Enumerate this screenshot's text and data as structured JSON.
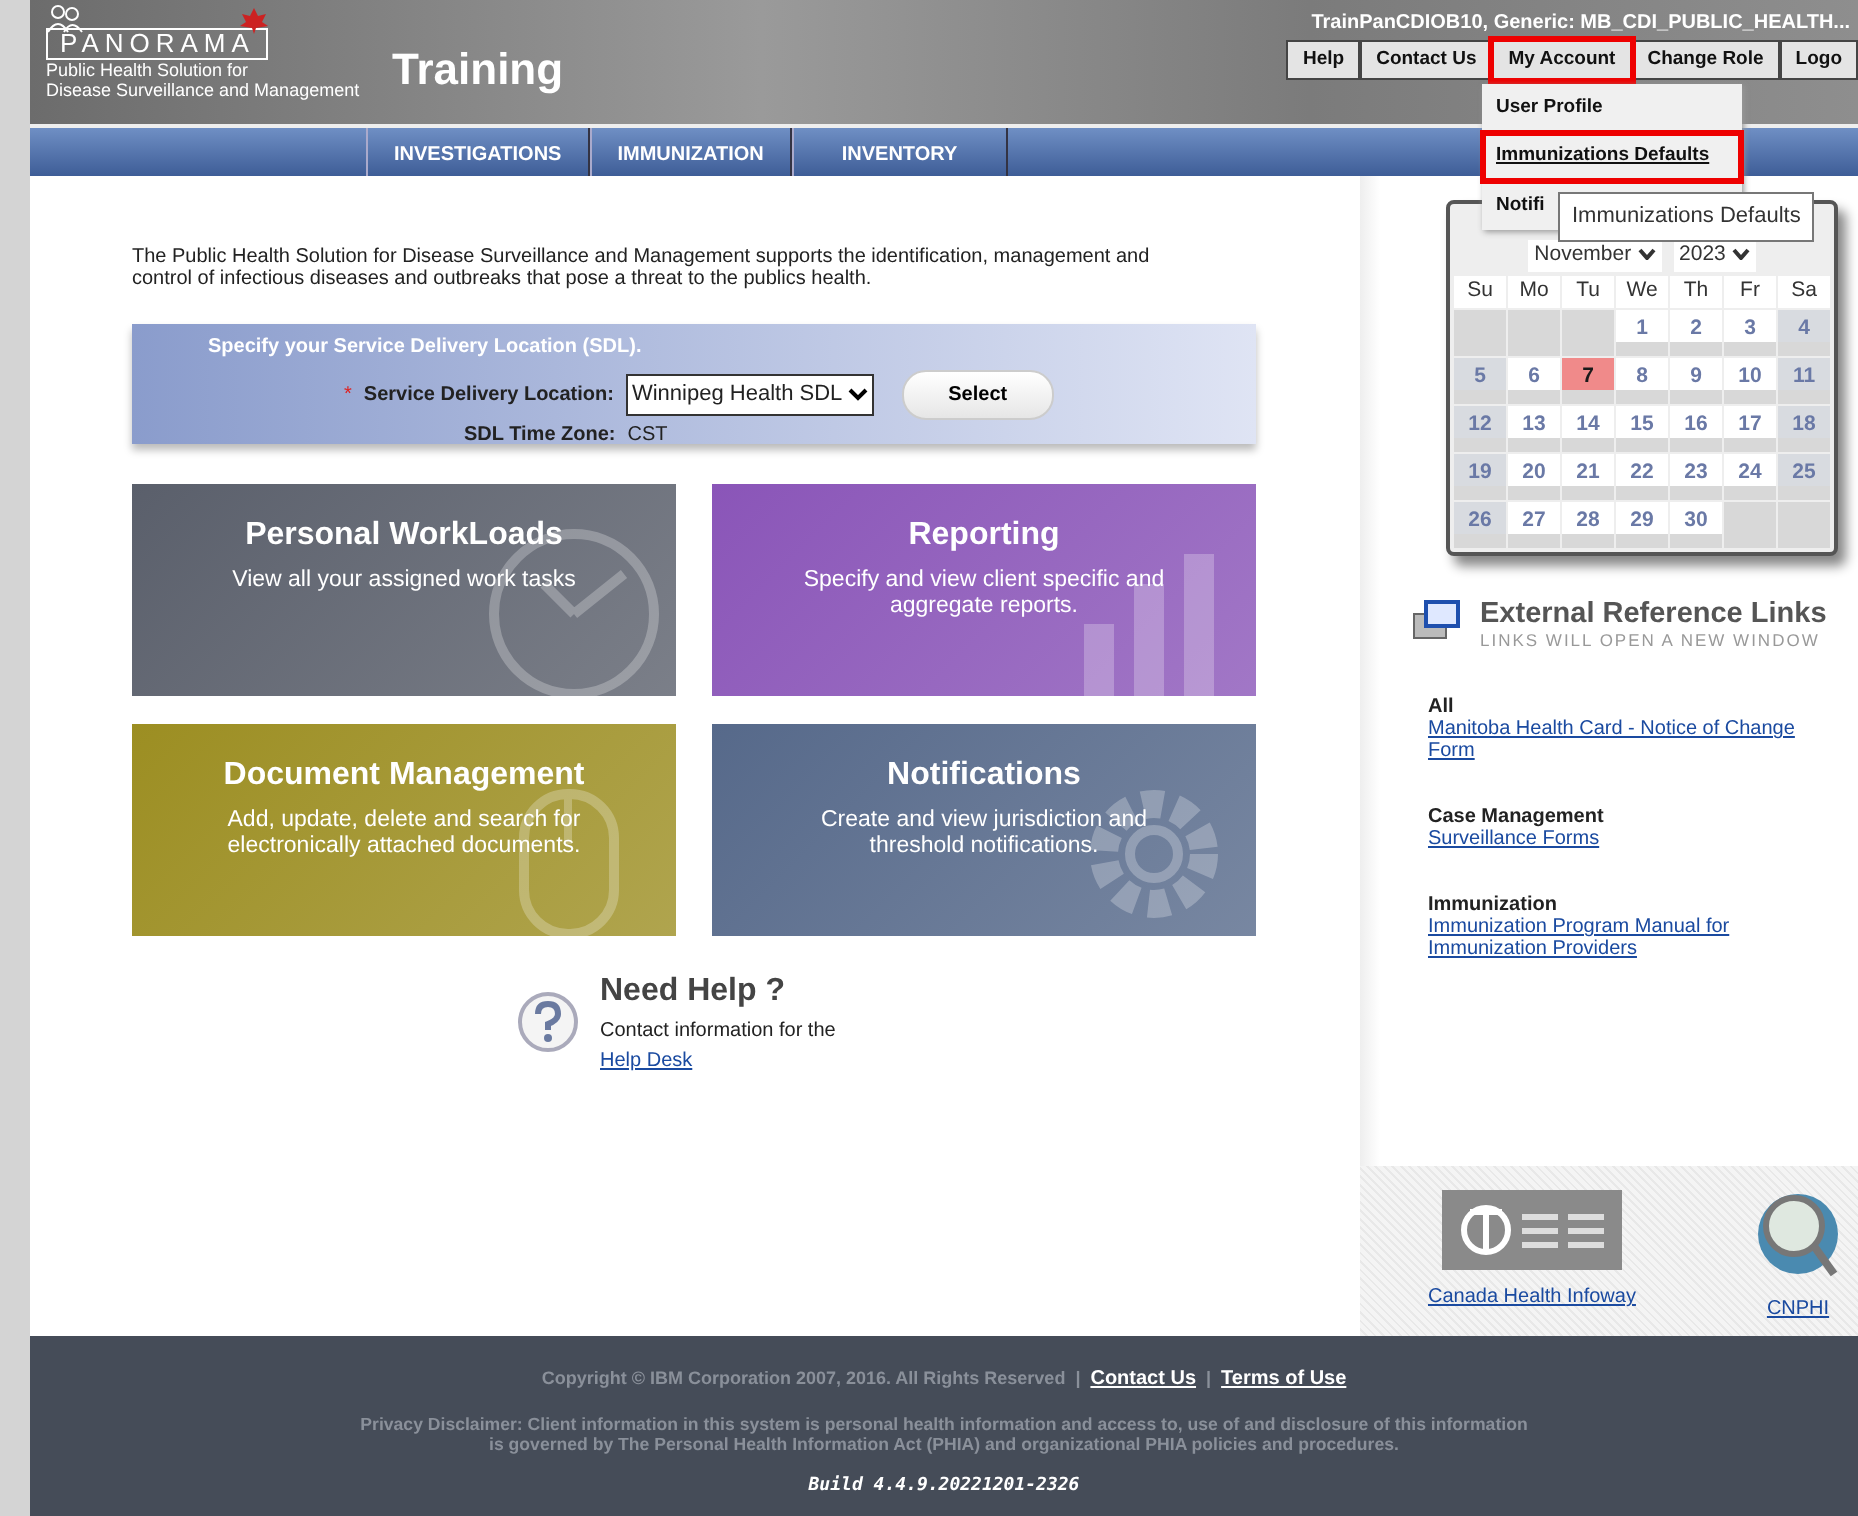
{
  "header": {
    "logo": "PANORAMA",
    "subtitle_lines": [
      "Public Health Solution for",
      "Disease Surveillance and Management"
    ],
    "environment": "Training",
    "user": "TrainPanCDIOB10, Generic: MB_CDI_PUBLIC_HEALTH...",
    "buttons": [
      {
        "label": "Help",
        "highlighted": false
      },
      {
        "label": "Contact Us",
        "highlighted": false
      },
      {
        "label": "My Account",
        "highlighted": true
      },
      {
        "label": "Change Role",
        "highlighted": false
      },
      {
        "label": "Logo",
        "highlighted": false
      }
    ]
  },
  "account_menu": {
    "items": [
      {
        "label": "User Profile",
        "highlighted": false
      },
      {
        "label": "Immunizations Defaults",
        "highlighted": true
      },
      {
        "label": "Notifi",
        "highlighted": false
      }
    ]
  },
  "tooltip": "Immunizations Defaults",
  "nav": {
    "items": [
      "INVESTIGATIONS",
      "IMMUNIZATION",
      "INVENTORY"
    ]
  },
  "intro": "The Public Health Solution for Disease Surveillance and Management supports the identification, management and control of infectious diseases and outbreaks that pose a threat to the publics health.",
  "sdl": {
    "heading": "Specify your Service Delivery Location (SDL).",
    "required_mark": "*",
    "label": "Service Delivery Location:",
    "value": "Winnipeg Health SDL",
    "button": "Select",
    "timezone_label": "SDL Time Zone:",
    "timezone": "CST"
  },
  "tiles": [
    {
      "kind": "clock",
      "title": "Personal WorkLoads",
      "description": "View all your assigned work tasks",
      "color": "#5a5f6b"
    },
    {
      "kind": "chart",
      "title": "Reporting",
      "description": "Specify and view client specific and aggregate reports.",
      "color": "#8a55b8"
    },
    {
      "kind": "mouse",
      "title": "Document Management",
      "description": "Add, update, delete and search for electronically attached documents.",
      "color": "#9c8e22"
    },
    {
      "kind": "gear",
      "title": "Notifications",
      "description": "Create and view jurisdiction and threshold notifications.",
      "color": "#56698a"
    }
  ],
  "help": {
    "title": "Need Help ?",
    "text": "Contact information for the",
    "link": "Help Desk"
  },
  "calendar": {
    "month": "November",
    "year": "2023",
    "weekdays": [
      "Su",
      "Mo",
      "Tu",
      "We",
      "Th",
      "Fr",
      "Sa"
    ],
    "weeks": [
      [
        {
          "kind": "blank"
        },
        {
          "kind": "blank"
        },
        {
          "kind": "blank"
        },
        {
          "day": "1",
          "today": false
        },
        {
          "day": "2",
          "today": false
        },
        {
          "day": "3",
          "today": false
        },
        {
          "day": "4",
          "today": false
        }
      ],
      [
        {
          "day": "5",
          "today": false
        },
        {
          "day": "6",
          "today": false
        },
        {
          "day": "7",
          "today": true
        },
        {
          "day": "8",
          "today": false
        },
        {
          "day": "9",
          "today": false
        },
        {
          "day": "10",
          "today": false
        },
        {
          "day": "11",
          "today": false
        }
      ],
      [
        {
          "day": "12",
          "today": false
        },
        {
          "day": "13",
          "today": false
        },
        {
          "day": "14",
          "today": false
        },
        {
          "day": "15",
          "today": false
        },
        {
          "day": "16",
          "today": false
        },
        {
          "day": "17",
          "today": false
        },
        {
          "day": "18",
          "today": false
        }
      ],
      [
        {
          "day": "19",
          "today": false
        },
        {
          "day": "20",
          "today": false
        },
        {
          "day": "21",
          "today": false
        },
        {
          "day": "22",
          "today": false
        },
        {
          "day": "23",
          "today": false
        },
        {
          "day": "24",
          "today": false
        },
        {
          "day": "25",
          "today": false
        }
      ],
      [
        {
          "day": "26",
          "today": false
        },
        {
          "day": "27",
          "today": false
        },
        {
          "day": "28",
          "today": false
        },
        {
          "day": "29",
          "today": false
        },
        {
          "day": "30",
          "today": false
        },
        {
          "kind": "blank"
        },
        {
          "kind": "blank"
        }
      ]
    ]
  },
  "external_links": {
    "title": "External Reference Links",
    "subtitle": "LINKS WILL OPEN A NEW WINDOW",
    "groups": [
      {
        "heading": "All",
        "links": [
          "Manitoba Health Card - Notice of Change Form"
        ]
      },
      {
        "heading": "Case Management",
        "links": [
          "Surveillance Forms"
        ]
      },
      {
        "heading": "Immunization",
        "links": [
          "Immunization Program Manual for Immunization Providers"
        ]
      }
    ]
  },
  "partners": [
    {
      "kind": "infoway",
      "label": "Canada Health Infoway"
    },
    {
      "kind": "cnphi",
      "label": "CNPHI"
    }
  ],
  "footer": {
    "separator": "|",
    "copyright": "Copyright © IBM Corporation 2007, 2016. All Rights Reserved",
    "links": [
      "Contact Us",
      "Terms of Use"
    ],
    "privacy_lines": [
      "Privacy Disclaimer: Client information in this system is personal health information and access to, use of and disclosure of this information",
      "is governed by The Personal Health Information Act (PHIA) and organizational PHIA policies and procedures."
    ],
    "build": "Build 4.4.9.20221201-2326"
  }
}
